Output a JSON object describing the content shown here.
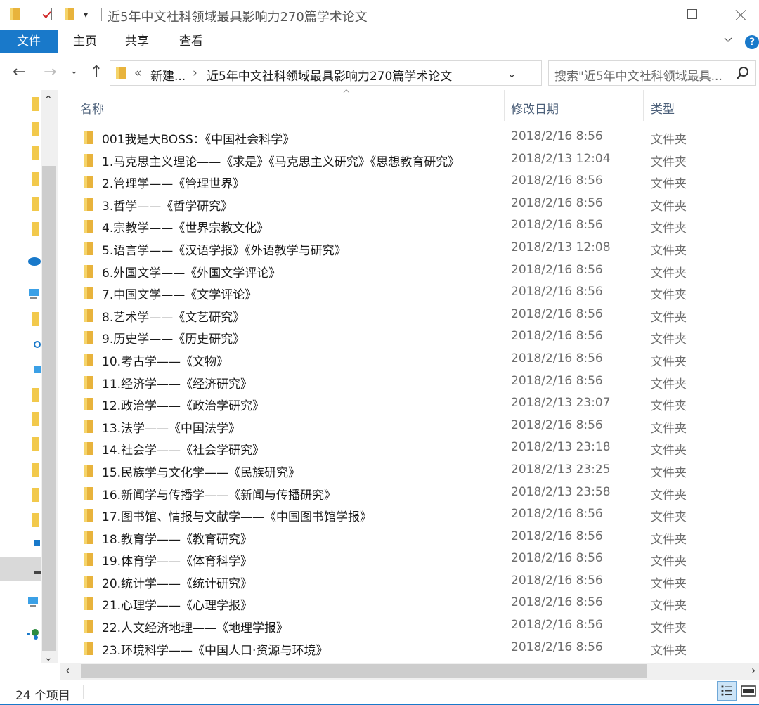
{
  "window": {
    "title": "近5年中文社科领域最具影响力270篇学术论文"
  },
  "ribbon": {
    "tabs": [
      "文件",
      "主页",
      "共享",
      "查看"
    ],
    "help_label": "?"
  },
  "address": {
    "overflow": "«",
    "crumbs": [
      "新建...",
      "近5年中文社科领域最具影响力270篇学术论文"
    ],
    "separator": "›"
  },
  "search": {
    "placeholder": "搜索\"近5年中文社科领域最具..."
  },
  "columns": {
    "name": "名称",
    "date": "修改日期",
    "type": "类型"
  },
  "files": [
    {
      "name": "001我是大BOSS：《中国社会科学》",
      "date": "2018/2/16 8:56",
      "type": "文件夹"
    },
    {
      "name": "1.马克思主义理论——《求是》《马克思主义研究》《思想教育研究》",
      "date": "2018/2/13 12:04",
      "type": "文件夹"
    },
    {
      "name": "2.管理学——《管理世界》",
      "date": "2018/2/16 8:56",
      "type": "文件夹"
    },
    {
      "name": "3.哲学——《哲学研究》",
      "date": "2018/2/16 8:56",
      "type": "文件夹"
    },
    {
      "name": "4.宗教学——《世界宗教文化》",
      "date": "2018/2/16 8:56",
      "type": "文件夹"
    },
    {
      "name": "5.语言学——《汉语学报》《外语教学与研究》",
      "date": "2018/2/13 12:08",
      "type": "文件夹"
    },
    {
      "name": "6.外国文学——《外国文学评论》",
      "date": "2018/2/16 8:56",
      "type": "文件夹"
    },
    {
      "name": "7.中国文学——《文学评论》",
      "date": "2018/2/16 8:56",
      "type": "文件夹"
    },
    {
      "name": "8.艺术学——《文艺研究》",
      "date": "2018/2/16 8:56",
      "type": "文件夹"
    },
    {
      "name": "9.历史学——《历史研究》",
      "date": "2018/2/16 8:56",
      "type": "文件夹"
    },
    {
      "name": "10.考古学——《文物》",
      "date": "2018/2/16 8:56",
      "type": "文件夹"
    },
    {
      "name": "11.经济学——《经济研究》",
      "date": "2018/2/16 8:56",
      "type": "文件夹"
    },
    {
      "name": "12.政治学——《政治学研究》",
      "date": "2018/2/13 23:07",
      "type": "文件夹"
    },
    {
      "name": "13.法学——《中国法学》",
      "date": "2018/2/16 8:56",
      "type": "文件夹"
    },
    {
      "name": "14.社会学——《社会学研究》",
      "date": "2018/2/13 23:18",
      "type": "文件夹"
    },
    {
      "name": "15.民族学与文化学——《民族研究》",
      "date": "2018/2/13 23:25",
      "type": "文件夹"
    },
    {
      "name": "16.新闻学与传播学——《新闻与传播研究》",
      "date": "2018/2/13 23:58",
      "type": "文件夹"
    },
    {
      "name": "17.图书馆、情报与文献学——《中国图书馆学报》",
      "date": "2018/2/16 8:56",
      "type": "文件夹"
    },
    {
      "name": "18.教育学——《教育研究》",
      "date": "2018/2/16 8:56",
      "type": "文件夹"
    },
    {
      "name": "19.体育学——《体育科学》",
      "date": "2018/2/16 8:56",
      "type": "文件夹"
    },
    {
      "name": "20.统计学——《统计研究》",
      "date": "2018/2/16 8:56",
      "type": "文件夹"
    },
    {
      "name": "21.心理学——《心理学报》",
      "date": "2018/2/16 8:56",
      "type": "文件夹"
    },
    {
      "name": "22.人文经济地理——《地理学报》",
      "date": "2018/2/16 8:56",
      "type": "文件夹"
    },
    {
      "name": "23.环境科学——《中国人口·资源与环境》",
      "date": "2018/2/16 8:56",
      "type": "文件夹"
    }
  ],
  "status": {
    "item_count": "24 个项目"
  },
  "colors": {
    "accent": "#1979ca",
    "folder": "#f2c94c",
    "header_text": "#4c607a"
  }
}
